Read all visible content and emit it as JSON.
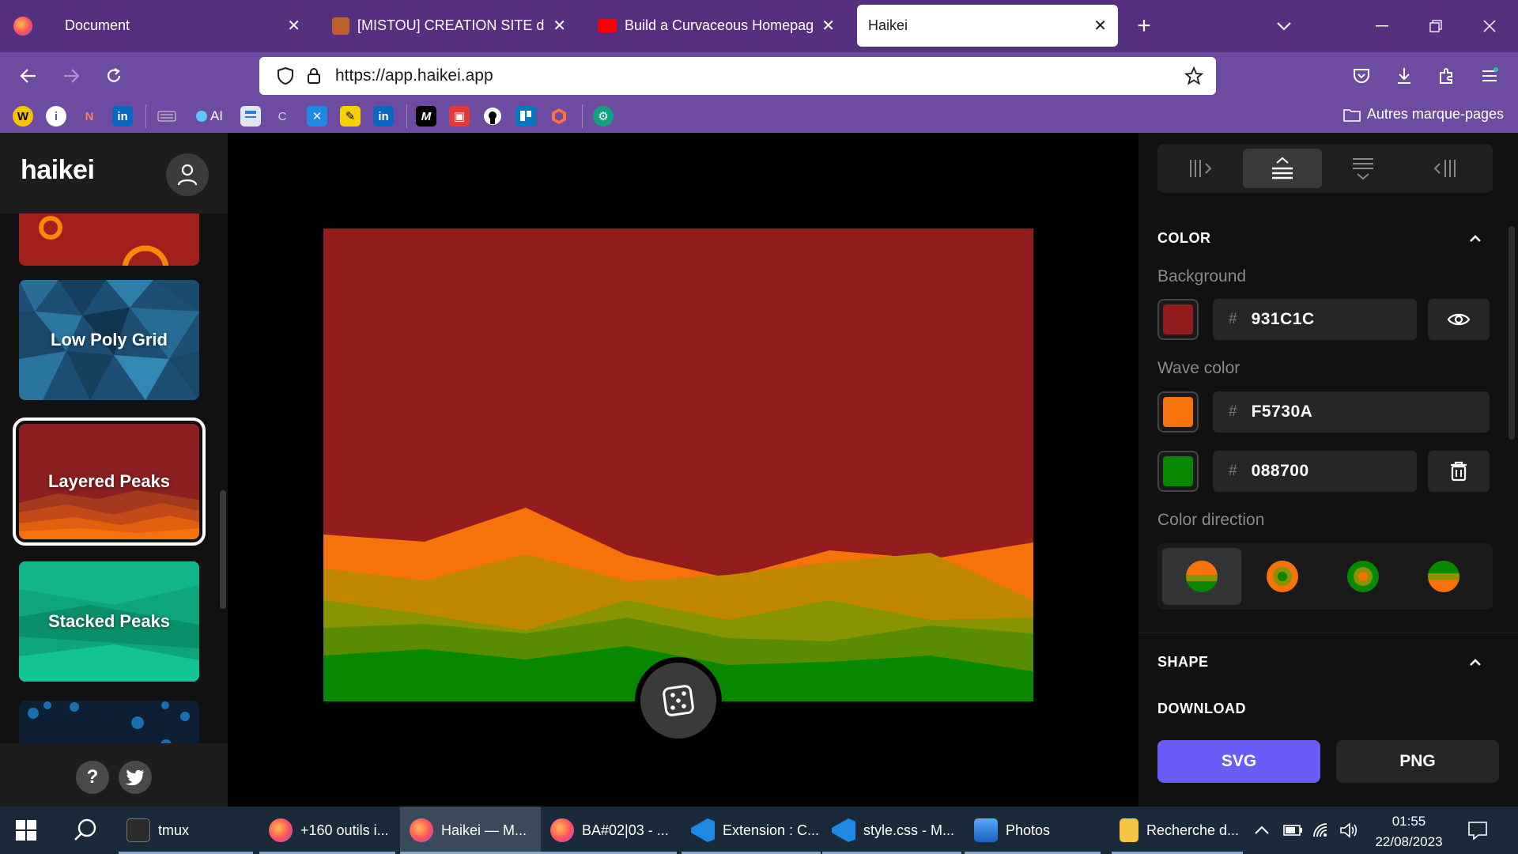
{
  "browser": {
    "tabs": [
      {
        "title": "Document",
        "icon_color": "#ff9500",
        "active": false
      },
      {
        "title": "[MISTOU] CREATION SITE de MISTOU",
        "icon_color": "#c06030",
        "active": false
      },
      {
        "title": "Build a Curvaceous Homepage / Haikei",
        "icon_color": "#ff0000",
        "active": false
      },
      {
        "title": "Haikei",
        "icon_color": "",
        "active": true
      }
    ],
    "new_tab": "+",
    "url": "https://app.haikei.app",
    "bookmarks_folder": "Autres marque-pages",
    "bookmark_ai_label": "AI",
    "bookmark_linkedin_label": "in",
    "bookmark_m_label": "M"
  },
  "sidebar": {
    "logo": "haikei",
    "cards": [
      {
        "label": "",
        "theme": "blobs"
      },
      {
        "label": "Low Poly Grid",
        "theme": "lowpoly"
      },
      {
        "label": "Layered Peaks",
        "theme": "layered",
        "selected": true
      },
      {
        "label": "Stacked Peaks",
        "theme": "stacked"
      },
      {
        "label": "",
        "theme": "hex"
      }
    ],
    "help_label": "?"
  },
  "canvas": {
    "background": "#931C1C",
    "layers": [
      "#F5730A",
      "#C08800",
      "#889400",
      "#5A8C00",
      "#088700"
    ]
  },
  "panel": {
    "color_section": "COLOR",
    "background_label": "Background",
    "background_hex": "931C1C",
    "background_color": "#931C1C",
    "wave_label": "Wave color",
    "wave_colors": [
      {
        "hex": "F5730A",
        "color": "#F5730A"
      },
      {
        "hex": "088700",
        "color": "#088700"
      }
    ],
    "hash": "#",
    "direction_label": "Color direction",
    "shape_section": "SHAPE",
    "download_section": "DOWNLOAD",
    "svg_label": "SVG",
    "png_label": "PNG",
    "svg_color": "#6a5cf6"
  },
  "taskbar": {
    "items": [
      {
        "label": "tmux",
        "icon": "terminal-icon"
      },
      {
        "label": "+160 outils i...",
        "icon": "firefox-icon"
      },
      {
        "label": "Haikei — M...",
        "icon": "firefox-icon"
      },
      {
        "label": "BA#02|03 - ...",
        "icon": "firefox-icon"
      },
      {
        "label": "Extension : C...",
        "icon": "vscode-icon"
      },
      {
        "label": "style.css - M...",
        "icon": "vscode-icon"
      },
      {
        "label": "Photos",
        "icon": "photos-icon"
      },
      {
        "label": "Recherche d...",
        "icon": "folder-icon"
      }
    ],
    "time": "01:55",
    "date": "22/08/2023"
  }
}
